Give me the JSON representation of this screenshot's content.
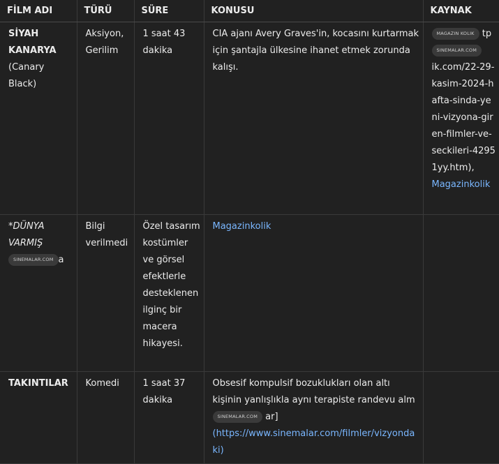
{
  "headers": [
    "FİLM ADI",
    "TÜRÜ",
    "SÜRE",
    "KONUSU",
    "KAYNAK"
  ],
  "rows": [
    {
      "title": "SİYAH KANARYA",
      "subtitle": "(Canary Black)",
      "genre": "Aksiyon, Gerilim",
      "duration": "1 saat 43 dakika",
      "plot": "CIA ajanı Avery Graves'in, kocasını kurtarmak için şantajla ülkesine ihanet etmek zorunda kalışı.",
      "source_chip1": "MAGAZIN KOLIK",
      "source_text1": "tp",
      "source_chip2": "SINEMALAR.COM",
      "source_text2": "ik.com/22-29-kasim-2024-hafta-sinda-yeni-vizyona-giren-filmler-ve-seckileri-42951yy.htm),",
      "source_link": "Magazinkolik"
    },
    {
      "title": "*DÜNYA VARMIŞ",
      "title_chip": "SINEMALAR.COM",
      "title_suffix": "a",
      "genre": "Bilgi verilmedi",
      "duration": "Özel tasarım kostümler ve görsel efektlerle desteklenen ilginç bir macera hikayesi.",
      "plot_link": "Magazinkolik"
    },
    {
      "title": "TAKINTILAR",
      "genre": "Komedi",
      "duration": "1 saat 37 dakika",
      "plot": "Obsesif kompulsif bozuklukları olan altı kişinin yanlışlıkla aynı terapiste randevu alm",
      "plot_chip": "SINEMALAR.COM",
      "plot_after_chip": "ar]",
      "plot_link": "(https://www.sinemalar.com/filmler/vizyondaki)"
    }
  ]
}
